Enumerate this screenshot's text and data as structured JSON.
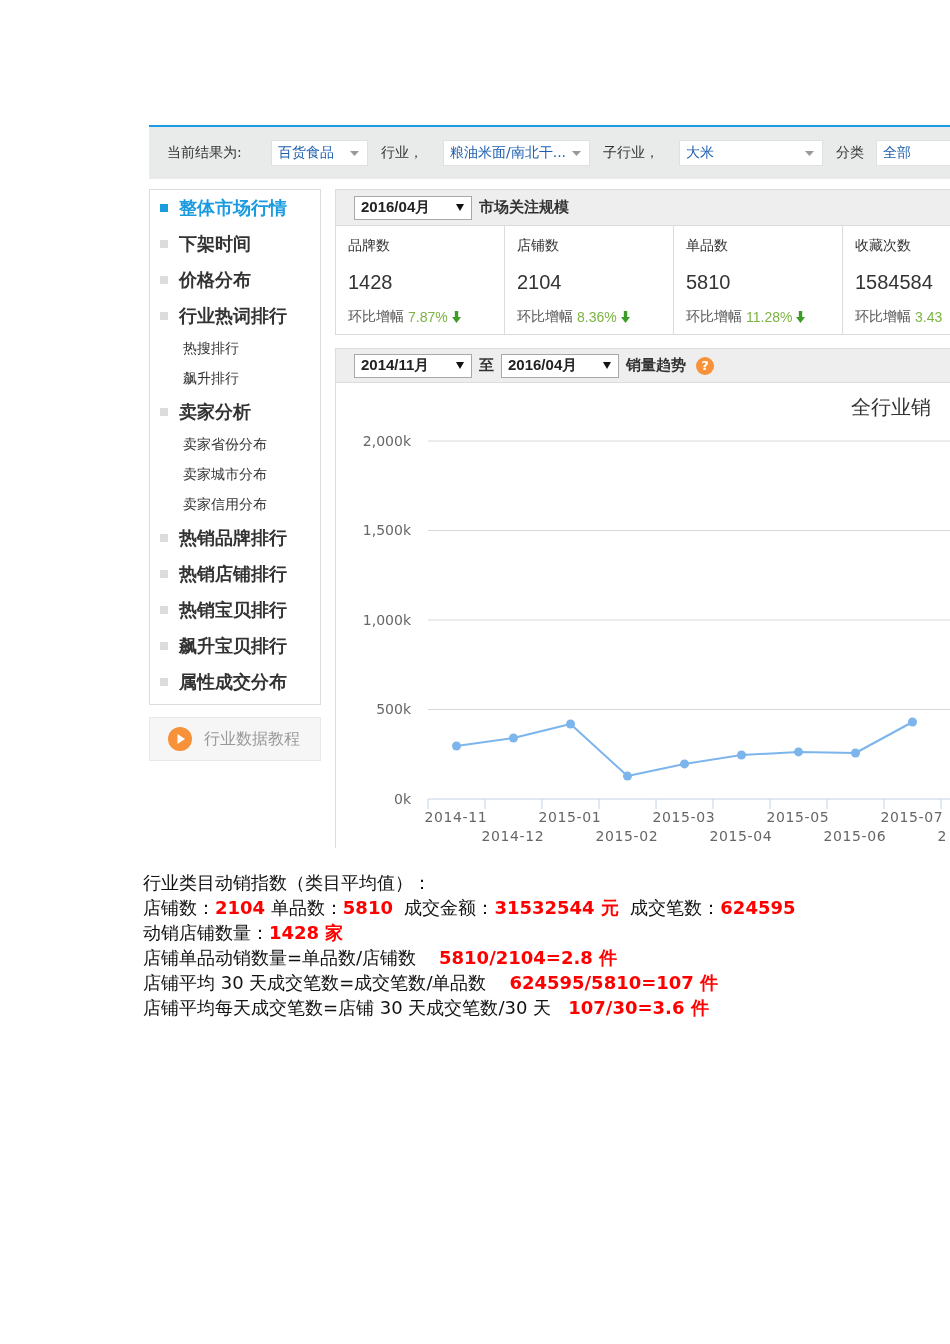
{
  "filter_bar": {
    "items": [
      {
        "kind": "label",
        "text": "当前结果为:"
      },
      {
        "kind": "dropdown",
        "value": "百货食品",
        "caret": true
      },
      {
        "kind": "label",
        "text": "行业，"
      },
      {
        "kind": "dropdown",
        "value": "粮油米面/南北干...",
        "caret": true
      },
      {
        "kind": "label",
        "text": "子行业，"
      },
      {
        "kind": "dropdown",
        "value": "大米",
        "caret": true
      },
      {
        "kind": "label",
        "text": "分类"
      },
      {
        "kind": "dropdown",
        "value": "全部"
      }
    ]
  },
  "sidebar": {
    "items": [
      {
        "label": "整体市场行情",
        "selected": true
      },
      {
        "label": "下架时间",
        "selected": false
      },
      {
        "label": "价格分布",
        "selected": false
      },
      {
        "label": "行业热词排行",
        "selected": false,
        "children": [
          {
            "label": "热搜排行",
            "selected": false
          },
          {
            "label": "飙升排行",
            "selected": false
          }
        ]
      },
      {
        "label": "卖家分析",
        "selected": false,
        "children": [
          {
            "label": "卖家省份分布",
            "selected": false
          },
          {
            "label": "卖家城市分布",
            "selected": false
          },
          {
            "label": "卖家信用分布",
            "selected": false
          }
        ]
      },
      {
        "label": "热销品牌排行",
        "selected": false
      },
      {
        "label": "热销店铺排行",
        "selected": false
      },
      {
        "label": "热销宝贝排行",
        "selected": false
      },
      {
        "label": "飙升宝贝排行",
        "selected": false
      },
      {
        "label": "属性成交分布",
        "selected": false
      }
    ],
    "tutorial_button": {
      "label": "行业数据教程"
    }
  },
  "market_panel": {
    "period": "2016/04月",
    "title": "市场关注规模",
    "stats": [
      {
        "label": "品牌数",
        "value": "1428",
        "change_label": "环比增幅",
        "change": "7.87%",
        "down": true
      },
      {
        "label": "店铺数",
        "value": "2104",
        "change_label": "环比增幅",
        "change": "8.36%",
        "down": true
      },
      {
        "label": "单品数",
        "value": "5810",
        "change_label": "环比增幅",
        "change": "11.28%",
        "down": true
      },
      {
        "label": "收藏次数",
        "value": "1584584",
        "change_label": "环比增幅",
        "change": "3.43"
      }
    ]
  },
  "trend_panel": {
    "from": "2014/11月",
    "separator": "至",
    "to": "2016/04月",
    "title": "销量趋势",
    "help": "?",
    "chart_data": {
      "type": "line",
      "title": "全行业销",
      "categories": [
        "2014-11",
        "2014-12",
        "2015-01",
        "2015-02",
        "2015-03",
        "2015-04",
        "2015-05",
        "2015-06",
        "2015-07",
        "2"
      ],
      "values": [
        296000,
        341000,
        419000,
        128000,
        196000,
        246000,
        263000,
        257000,
        430000,
        null
      ],
      "ylim": [
        0,
        2000000
      ],
      "yticks": [
        {
          "value": 0,
          "label": "0k"
        },
        {
          "value": 500000,
          "label": "500k"
        },
        {
          "value": 1000000,
          "label": "1,000k"
        },
        {
          "value": 1500000,
          "label": "1,500k"
        },
        {
          "value": 2000000,
          "label": "2,000k"
        }
      ],
      "grid": true,
      "marker": true
    }
  },
  "notes": [
    "行业类目动销指数（类目平均值）：",
    "店铺数：**2104** 单品数：**5810**  成交金额：**31532544 元**  成交笔数：**624595**",
    "动销店铺数量：**1428 家**",
    "店铺单品动销数量=单品数/店铺数    **5810/2104=2.8 件**",
    "店铺平均 30 天成交笔数=成交笔数/单品数    **624595/5810=107 件**",
    "店铺平均每天成交笔数=店铺 30 天成交笔数/30 天   **107/30=3.6 件**"
  ]
}
